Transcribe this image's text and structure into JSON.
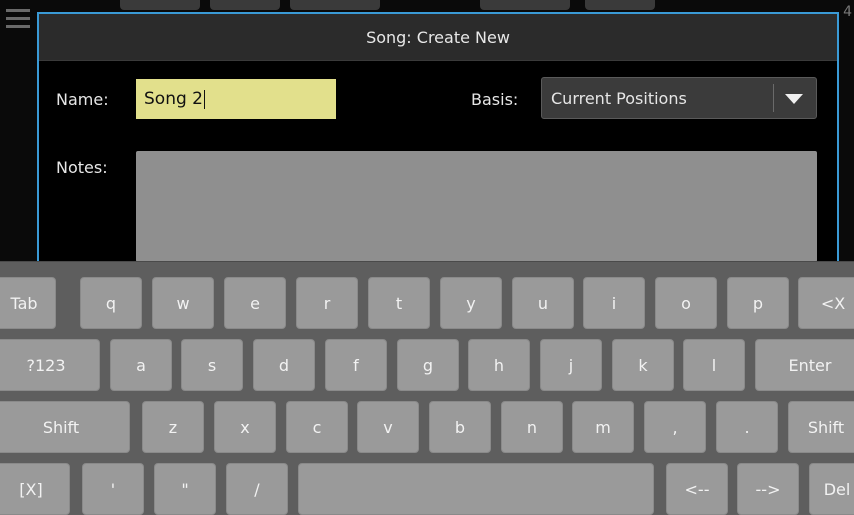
{
  "dialog": {
    "title": "Song: Create New",
    "name_label": "Name:",
    "name_value": "Song 2",
    "basis_label": "Basis:",
    "basis_value": "Current Positions",
    "notes_label": "Notes:",
    "notes_value": ""
  },
  "background": {
    "corner_number": "4"
  },
  "keyboard": {
    "rows": [
      [
        "Tab",
        "q",
        "w",
        "e",
        "r",
        "t",
        "y",
        "u",
        "i",
        "o",
        "p",
        "<X"
      ],
      [
        "?123",
        "a",
        "s",
        "d",
        "f",
        "g",
        "h",
        "j",
        "k",
        "l",
        "Enter"
      ],
      [
        "Shift",
        "z",
        "x",
        "c",
        "v",
        "b",
        "n",
        "m",
        ",",
        ".",
        "Shift"
      ],
      [
        "[X]",
        "'",
        "\"",
        "/",
        "",
        "<--",
        "-->",
        "Del"
      ]
    ]
  },
  "colors": {
    "accent_border": "#3a9ad6",
    "name_field_bg": "#e2e08c",
    "key_bg": "#9a9a9a",
    "keyboard_bg": "#5e5e5e"
  }
}
